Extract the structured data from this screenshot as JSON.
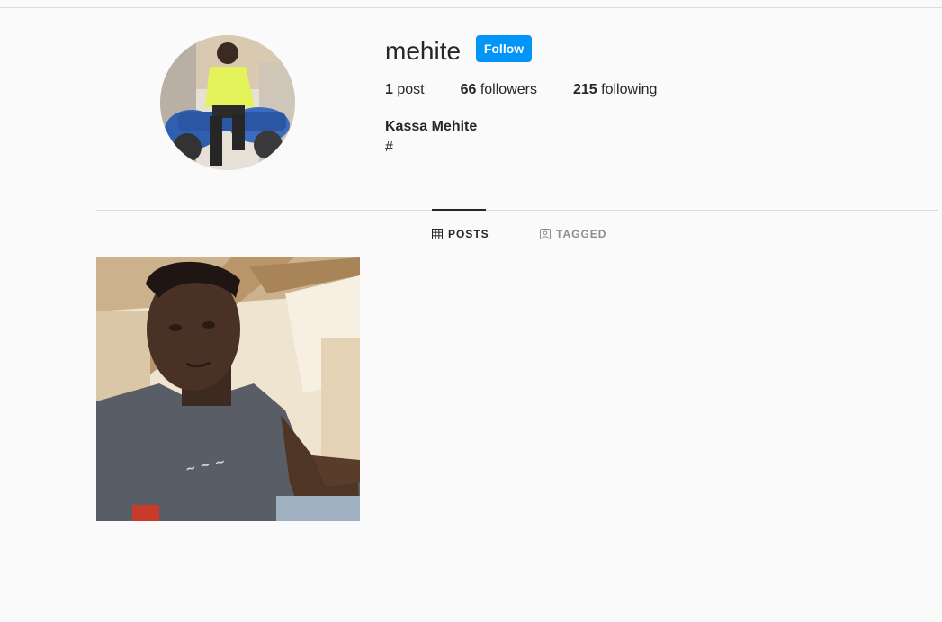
{
  "profile": {
    "username": "mehite",
    "follow_label": "Follow",
    "posts_count": "1",
    "posts_label": " post",
    "followers_count": "66",
    "followers_label": " followers",
    "following_count": "215",
    "following_label": " following",
    "full_name": "Kassa Mehite",
    "bio": "#"
  },
  "tabs": {
    "posts_label": "POSTS",
    "tagged_label": "TAGGED",
    "active": "posts"
  },
  "colors": {
    "accent": "#0095f6",
    "text": "#262626",
    "muted": "#8e8e8e",
    "background": "#fafafa"
  },
  "icons": {
    "posts_tab": "grid-icon",
    "tagged_tab": "tagged-person-icon"
  }
}
